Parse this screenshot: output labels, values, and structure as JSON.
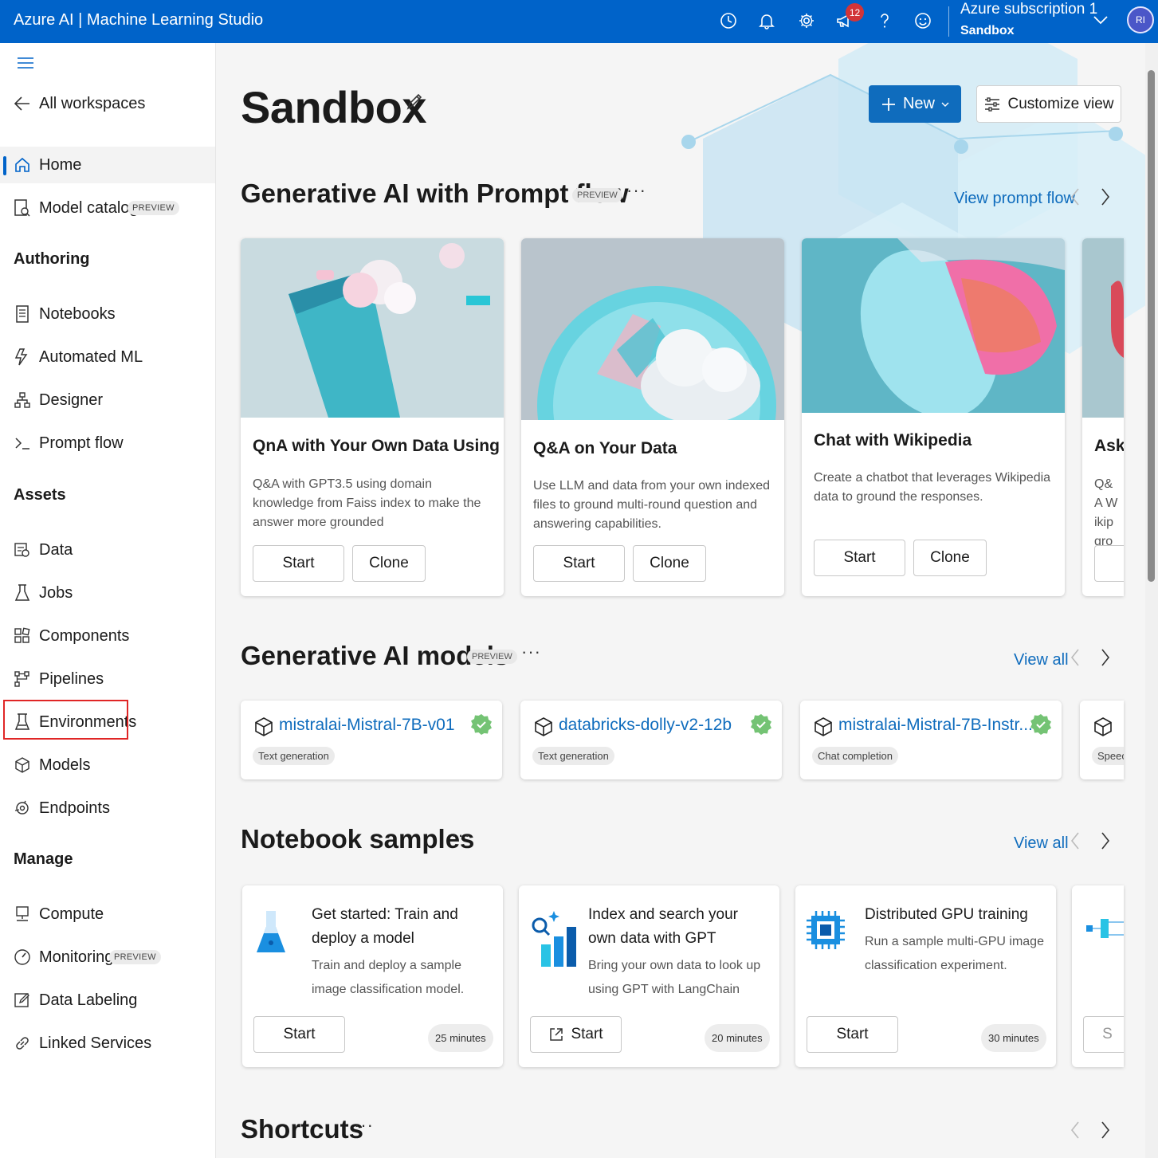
{
  "app": {
    "title": "Azure AI | Machine Learning Studio",
    "notifications_count": "12",
    "subscription": "Azure subscription 1",
    "workspace": "Sandbox",
    "avatar_initials": "RI",
    "accent": "#0063c9"
  },
  "sidebar": {
    "back": "All workspaces",
    "home": "Home",
    "model_catalog": "Model catalog",
    "preview_badge": "PREVIEW",
    "authoring_header": "Authoring",
    "authoring": [
      "Notebooks",
      "Automated ML",
      "Designer",
      "Prompt flow"
    ],
    "assets_header": "Assets",
    "assets": [
      "Data",
      "Jobs",
      "Components",
      "Pipelines",
      "Environments",
      "Models",
      "Endpoints"
    ],
    "manage_header": "Manage",
    "manage": [
      "Compute",
      "Monitoring",
      "Data Labeling",
      "Linked Services"
    ]
  },
  "main": {
    "title": "Sandbox",
    "new_label": "New",
    "customize_label": "Customize view",
    "prompt_flow": {
      "title": "Generative AI with Prompt flow",
      "badge": "PREVIEW",
      "more": "···",
      "link": "View prompt flow",
      "cards": [
        {
          "title": "QnA with Your Own Data Using ...",
          "desc": "Q&A with GPT3.5 using domain knowledge from Faiss index to make the answer more grounded",
          "start": "Start",
          "clone": "Clone"
        },
        {
          "title": "Q&A on Your Data",
          "desc": "Use LLM and data from your own indexed files to ground multi-round question and answering capabilities.",
          "start": "Start",
          "clone": "Clone"
        },
        {
          "title": "Chat with Wikipedia",
          "desc": "Create a chatbot that leverages Wikipedia data to ground the responses.",
          "start": "Start",
          "clone": "Clone"
        },
        {
          "title": "Ask",
          "desc": "Q&A Wikip groun"
        }
      ]
    },
    "models": {
      "title": "Generative AI models",
      "badge": "PREVIEW",
      "more": "···",
      "link": "View all",
      "cards": [
        {
          "name": "mistralai-Mistral-7B-v01",
          "tag": "Text generation"
        },
        {
          "name": "databricks-dolly-v2-12b",
          "tag": "Text generation"
        },
        {
          "name": "mistralai-Mistral-7B-Instr...",
          "tag": "Chat completion"
        },
        {
          "name": "",
          "tag": "Speec"
        }
      ]
    },
    "notebooks": {
      "title": "Notebook samples",
      "more": "···",
      "link": "View all",
      "cards": [
        {
          "title": "Get started: Train and deploy a model",
          "desc": "Train and deploy a sample image classification model.",
          "start": "Start",
          "duration": "25 minutes"
        },
        {
          "title": "Index and search your own data with GPT",
          "desc": "Bring your own data to look up using GPT with LangChain",
          "start": "Start",
          "duration": "20 minutes"
        },
        {
          "title": "Distributed GPU training",
          "desc": "Run a sample multi-GPU image classification experiment.",
          "start": "Start",
          "duration": "30 minutes"
        },
        {
          "start": "S"
        }
      ]
    },
    "shortcuts": {
      "title": "Shortcuts",
      "more": "···"
    }
  }
}
